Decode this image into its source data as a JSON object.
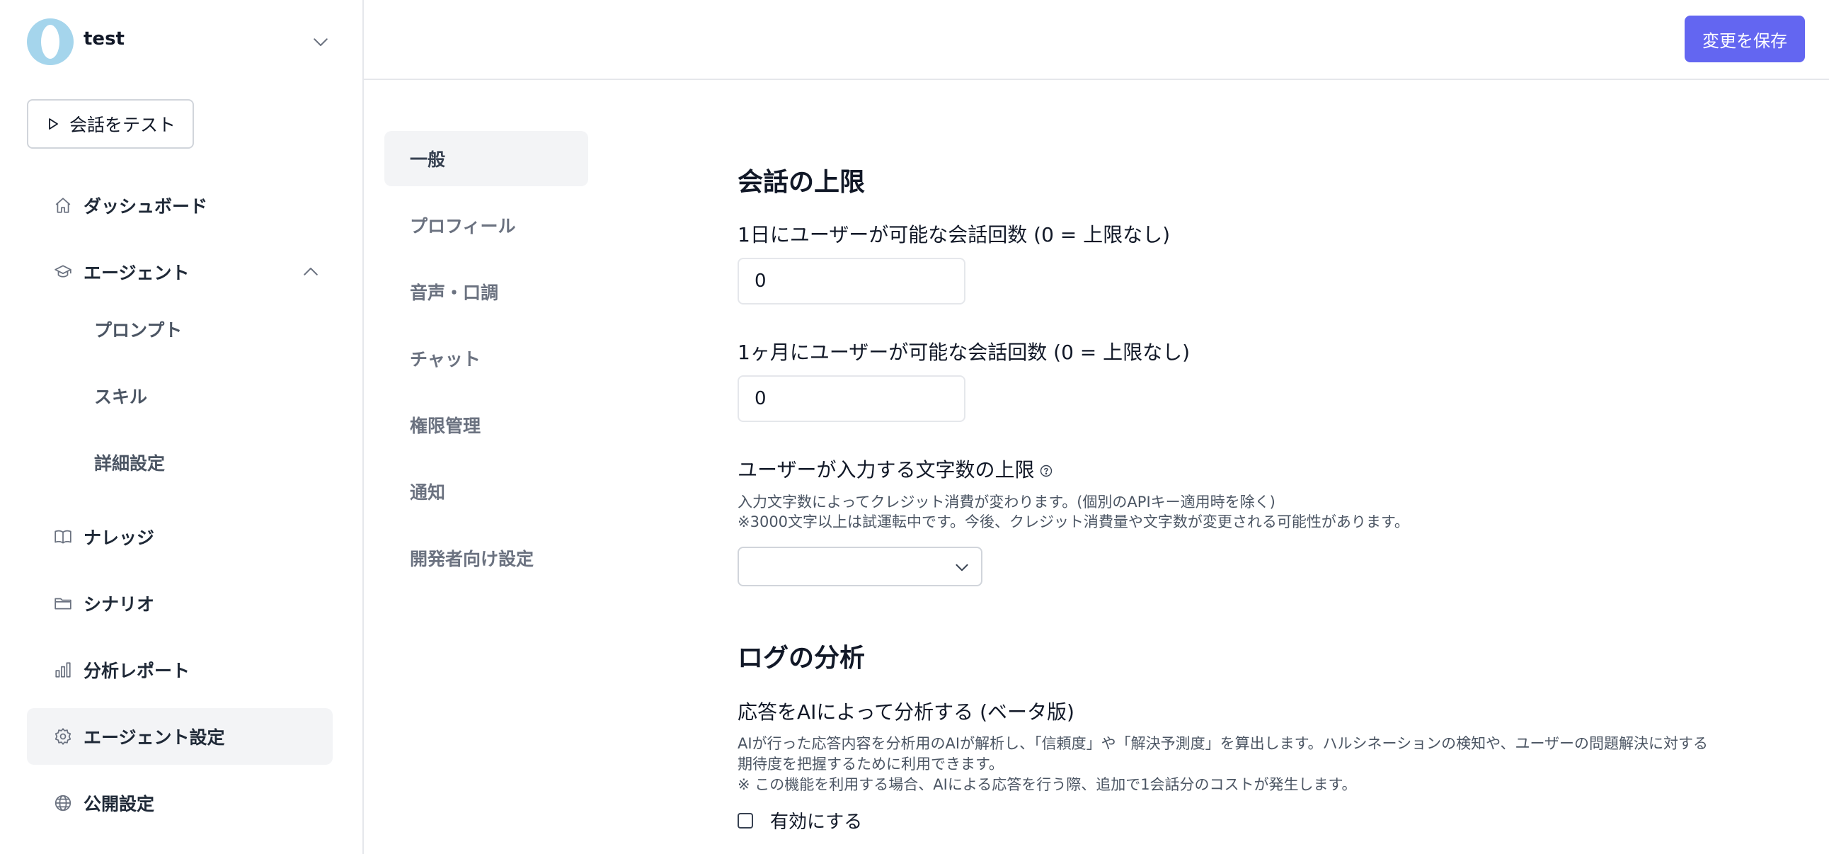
{
  "workspace": {
    "name": "test"
  },
  "sidebar": {
    "test_button": "会話をテスト",
    "items": [
      {
        "label": "ダッシュボード",
        "icon": "home-icon"
      },
      {
        "label": "エージェント",
        "icon": "graduation-cap-icon"
      },
      {
        "label": "ナレッジ",
        "icon": "book-icon"
      },
      {
        "label": "シナリオ",
        "icon": "folder-icon"
      },
      {
        "label": "分析レポート",
        "icon": "bar-chart-icon"
      },
      {
        "label": "エージェント設定",
        "icon": "gear-icon"
      },
      {
        "label": "公開設定",
        "icon": "globe-icon"
      }
    ],
    "agent_subitems": [
      "プロンプト",
      "スキル",
      "詳細設定"
    ]
  },
  "header": {
    "save_label": "変更を保存"
  },
  "settings_nav": [
    "一般",
    "プロフィール",
    "音声・口調",
    "チャット",
    "権限管理",
    "通知",
    "開発者向け設定"
  ],
  "main": {
    "limits": {
      "title": "会話の上限",
      "daily_label": "1日にユーザーが可能な会話回数 (0 = 上限なし)",
      "daily_value": "0",
      "monthly_label": "1ヶ月にユーザーが可能な会話回数 (0 = 上限なし)",
      "monthly_value": "0",
      "chars_label": "ユーザーが入力する文字数の上限",
      "chars_help1": "入力文字数によってクレジット消費が変わります。(個別のAPIキー適用時を除く)",
      "chars_help2": "※3000文字以上は試運転中です。今後、クレジット消費量や文字数が変更される可能性があります。",
      "chars_selected": ""
    },
    "log": {
      "title": "ログの分析",
      "ai_label": "応答をAIによって分析する (ベータ版)",
      "ai_help1": "AIが行った応答内容を分析用のAIが解析し、「信頼度」や「解決予測度」を算出します。ハルシネーションの検知や、ユーザーの問題解決に対する期待度を把握するために利用できます。",
      "ai_help2": "※ この機能を利用する場合、AIによる応答を行う際、追加で1会話分のコストが発生します。",
      "enable_label": "有効にする",
      "enabled": false
    }
  },
  "colors": {
    "primary": "#6366f1",
    "active_bg": "#f3f4f6",
    "logo": "#a5d5ec"
  }
}
